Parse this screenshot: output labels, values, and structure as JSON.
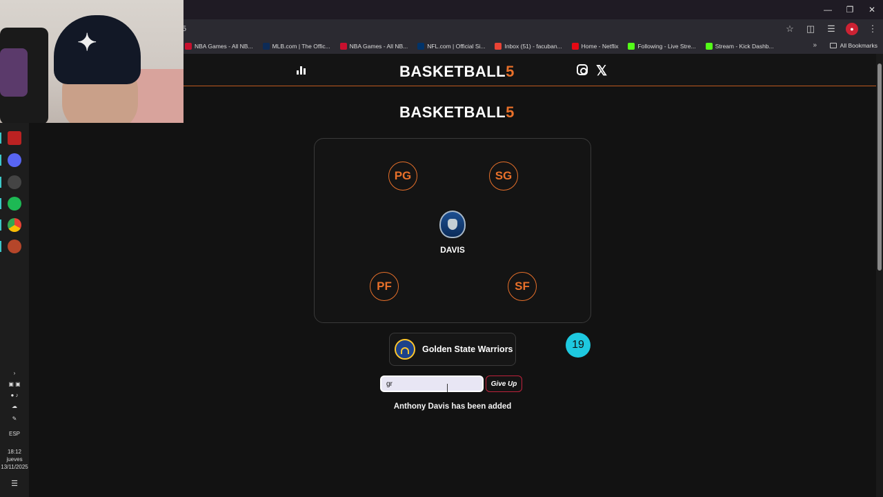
{
  "browser": {
    "url_fragment": "5",
    "bookmarks": [
      {
        "label": "NBA Games - All NB...",
        "color": "#c8102e"
      },
      {
        "label": "MLB.com | The Offic...",
        "color": "#0d2b56"
      },
      {
        "label": "NBA Games - All NB...",
        "color": "#c8102e"
      },
      {
        "label": "NFL.com | Official Si...",
        "color": "#013369"
      },
      {
        "label": "Inbox (51) - facuban...",
        "color": "#ea4335"
      },
      {
        "label": "Home - Netflix",
        "color": "#e50914"
      },
      {
        "label": "Following - Live Stre...",
        "color": "#53fc18"
      },
      {
        "label": "Stream - Kick Dashb...",
        "color": "#53fc18"
      }
    ],
    "all_bookmarks_label": "All Bookmarks"
  },
  "taskbar": {
    "language": "ESP",
    "time": "18:12",
    "day": "jueves",
    "date": "13/11/2025"
  },
  "site": {
    "brand_text": "BASKETBALL",
    "brand_number": "5",
    "page_title_text": "BASKETBALL",
    "page_title_number": "5"
  },
  "court": {
    "positions": {
      "pg": "PG",
      "sg": "SG",
      "pf": "PF",
      "sf": "SF"
    },
    "center_player": "DAVIS"
  },
  "clue": {
    "team_name": "Golden State Warriors"
  },
  "counter": "19",
  "guess": {
    "value": "gr"
  },
  "give_up_label": "Give Up",
  "message": "Anthony Davis has been added"
}
